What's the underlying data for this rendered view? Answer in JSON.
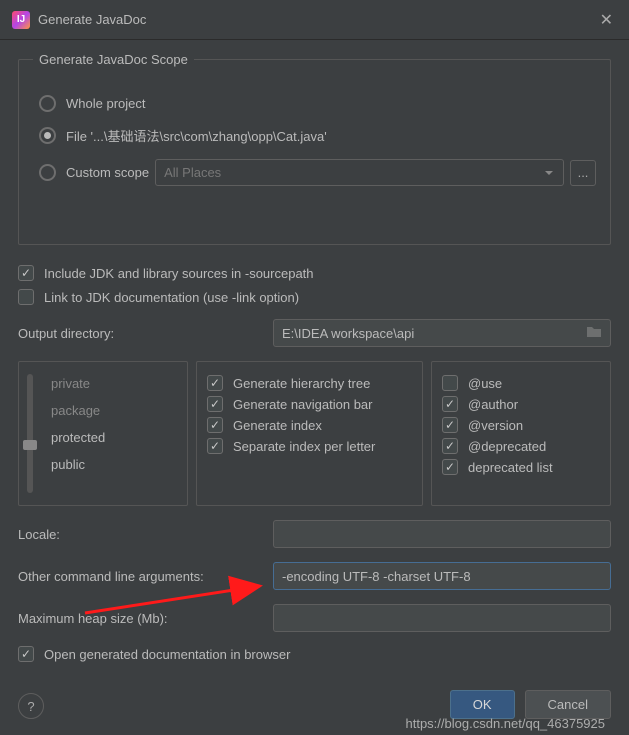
{
  "window": {
    "title": "Generate JavaDoc"
  },
  "scope": {
    "legend": "Generate JavaDoc Scope",
    "whole_project": "Whole project",
    "file_label": "File '...\\基础语法\\src\\com\\zhang\\opp\\Cat.java'",
    "custom_scope": "Custom scope",
    "custom_scope_value": "All Places",
    "more": "..."
  },
  "options": {
    "include_jdk": "Include JDK and library sources in -sourcepath",
    "link_jdk": "Link to JDK documentation (use -link option)"
  },
  "output": {
    "label": "Output directory:",
    "value": "E:\\IDEA workspace\\api"
  },
  "visibility": {
    "items": [
      "private",
      "package",
      "protected",
      "public"
    ],
    "selected": "protected"
  },
  "gen_options": {
    "hierarchy": "Generate hierarchy tree",
    "navbar": "Generate navigation bar",
    "index": "Generate index",
    "sep_index": "Separate index per letter"
  },
  "tags": {
    "use": "@use",
    "author": "@author",
    "version": "@version",
    "deprecated": "@deprecated",
    "deprecated_list": "deprecated list"
  },
  "locale": {
    "label": "Locale:",
    "value": ""
  },
  "cmdline": {
    "label": "Other command line arguments:",
    "value": "-encoding UTF-8 -charset UTF-8"
  },
  "heap": {
    "label": "Maximum heap size (Mb):",
    "value": ""
  },
  "open_browser": "Open generated documentation in browser",
  "buttons": {
    "ok": "OK",
    "cancel": "Cancel",
    "help": "?"
  },
  "watermark": "https://blog.csdn.net/qq_46375925"
}
